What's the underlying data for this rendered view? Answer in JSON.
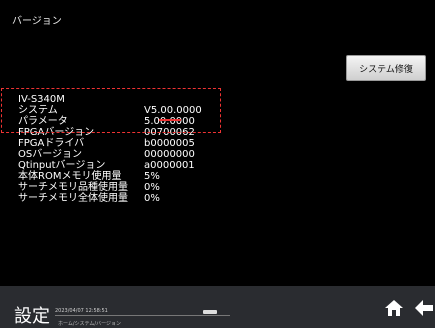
{
  "header": {
    "title": "バージョン",
    "repair_button": "システム修復"
  },
  "info": {
    "model": "IV-S340M",
    "rows": [
      {
        "label": "システム",
        "value": "V5.00.0000"
      },
      {
        "label": "パラメータ",
        "value": "5.00.0000"
      },
      {
        "label": "FPGAバージョン",
        "value": "00700062"
      },
      {
        "label": "FPGAドライバ",
        "value": "b0000005"
      },
      {
        "label": "OSバージョン",
        "value": "00000000"
      },
      {
        "label": "Qtinputバージョン",
        "value": "a0000001"
      },
      {
        "label": "本体ROMメモリ使用量",
        "value": "5%"
      },
      {
        "label": "サーチメモリ品種使用量",
        "value": "0%"
      },
      {
        "label": "サーチメモリ全体使用量",
        "value": "0%"
      }
    ]
  },
  "footer": {
    "title": "設定",
    "datetime": "2023/04/07 12:58:51",
    "breadcrumb": "ホーム/システム/バージョン"
  },
  "colors": {
    "background": "#000000",
    "footer": "#2a2c30",
    "highlight": "#e33333"
  }
}
